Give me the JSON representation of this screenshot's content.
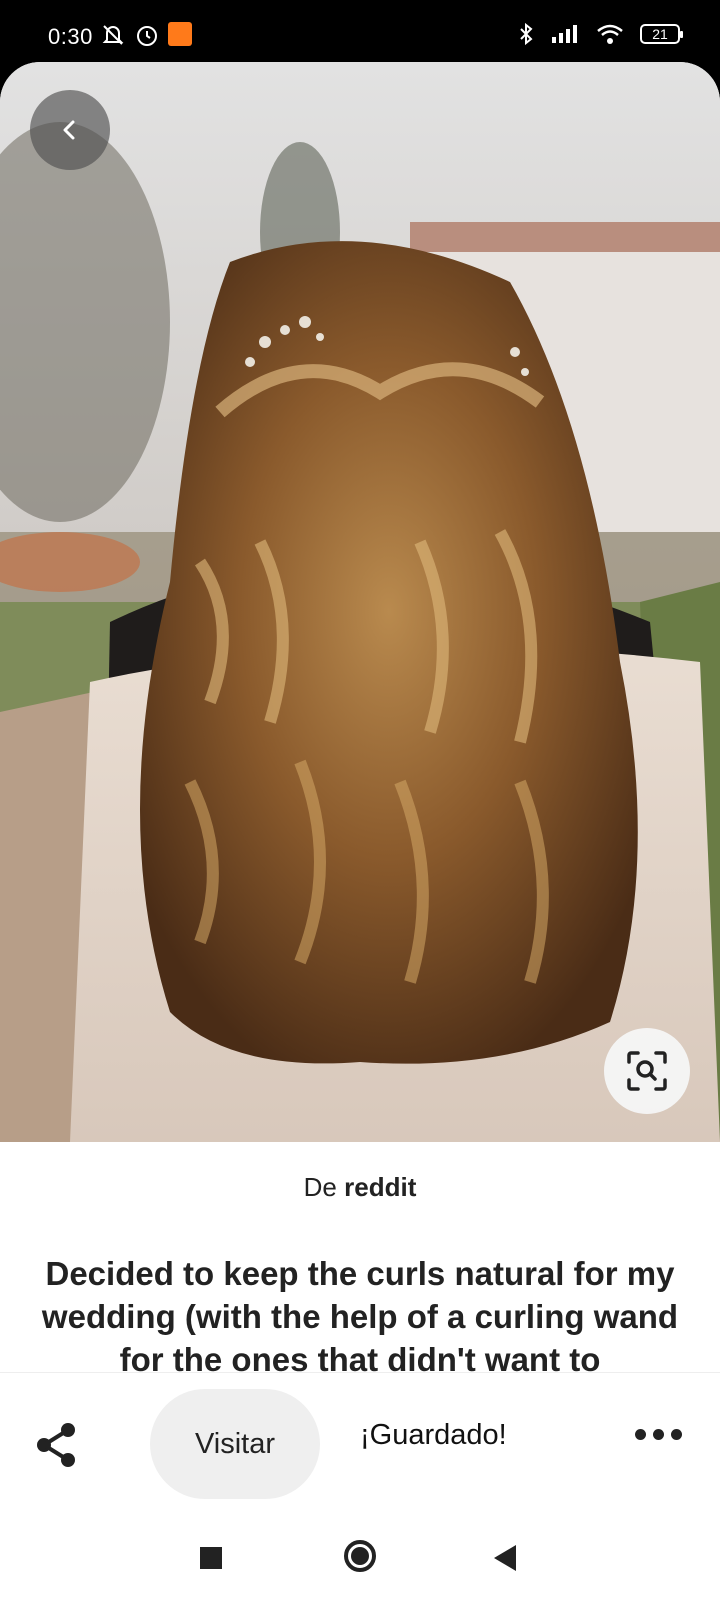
{
  "status_bar": {
    "time": "0:30",
    "battery": "21",
    "icons": [
      "mute-notifications-icon",
      "alarm-icon",
      "app-notification-icon",
      "bluetooth-icon",
      "signal-icon",
      "wifi-icon",
      "battery-icon"
    ]
  },
  "pin": {
    "source_prefix": "De",
    "source_name": "reddit",
    "title": "Decided to keep the curls natural for my wedding (with the help of a curling wand for the ones that didn't want to"
  },
  "actions": {
    "visit_label": "Visitar",
    "saved_label": "¡Guardado!"
  },
  "icons": {
    "back": "chevron-left-icon",
    "visual_search": "visual-search-icon",
    "share": "share-icon",
    "more": "more-icon"
  }
}
